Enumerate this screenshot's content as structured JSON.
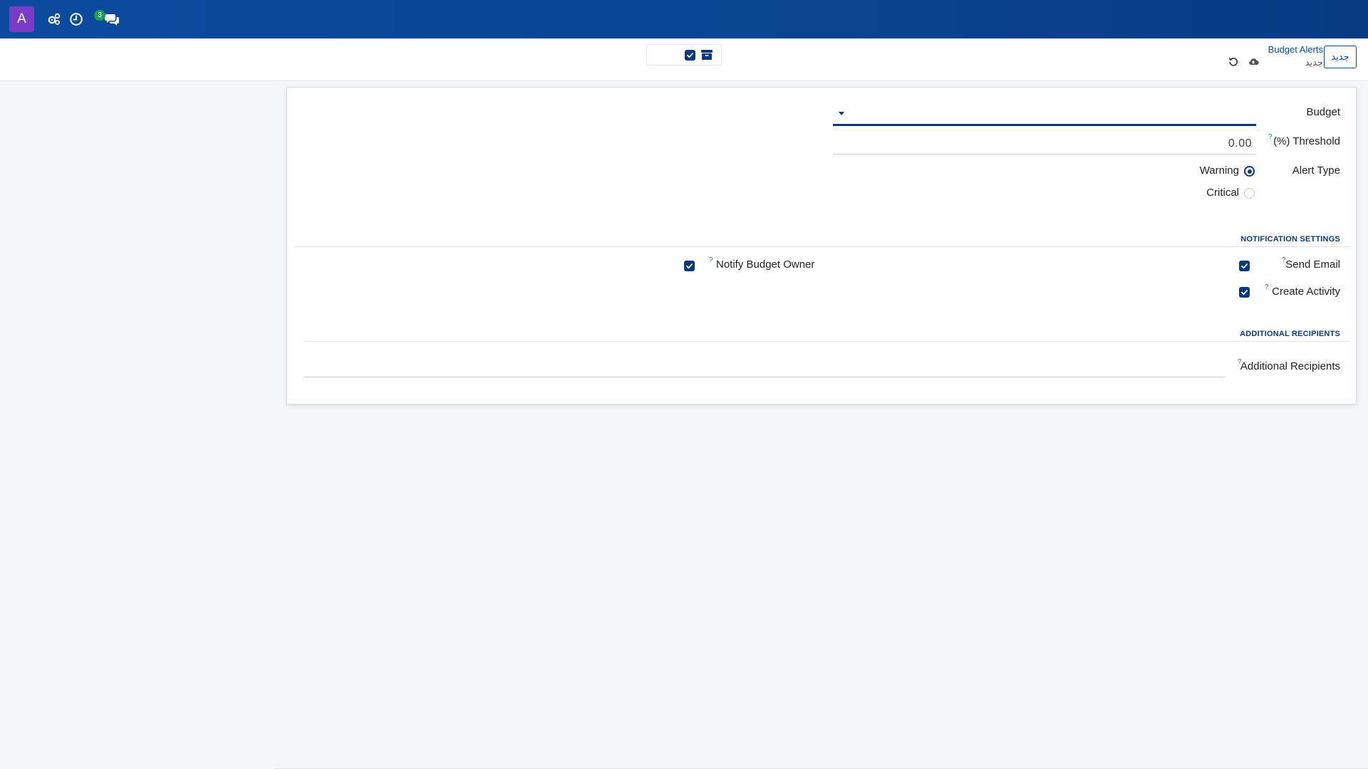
{
  "topbar": {
    "app_avatar_letter": "A",
    "messages_badge": "3",
    "icons": [
      "settings-cogs-icon",
      "clock-icon",
      "chat-icon"
    ]
  },
  "controlbar": {
    "new_button_label": "جديد",
    "breadcrumb_parent": "Budget Alerts",
    "breadcrumb_current": "جديد"
  },
  "form": {
    "budget_label": "Budget",
    "budget_value": "",
    "threshold_label": "(%) Threshold",
    "threshold_value": "0.00",
    "alert_type_label": "Alert Type",
    "alert_type_options": [
      "Warning",
      "Critical"
    ],
    "alert_type_selected": "Warning",
    "help_mark": "?"
  },
  "notification": {
    "section_title": "NOTIFICATION SETTINGS",
    "send_email_label": "Send Email",
    "send_email_checked": true,
    "create_activity_label": "Create Activity",
    "create_activity_checked": true,
    "notify_owner_label": "Notify Budget Owner",
    "notify_owner_checked": true
  },
  "recipients": {
    "section_title": "ADDITIONAL RECIPIENTS",
    "field_label": "Additional Recipients",
    "field_value": ""
  },
  "colors": {
    "topbar": "#0b4a9e",
    "accent": "#0b3a7a",
    "avatar": "#7b3cc5",
    "badge": "#1f9d55"
  }
}
